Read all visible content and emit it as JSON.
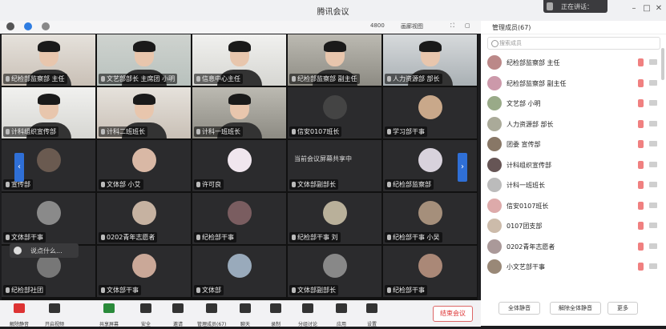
{
  "window": {
    "title": "腾讯会议",
    "speaking_label": "正在讲话："
  },
  "subbar": {
    "layout_label": "画廊视图",
    "signal_label": "4800"
  },
  "grid": {
    "tiles": [
      {
        "name": "纪检部监察部 主任",
        "kind": "video",
        "v": "v1"
      },
      {
        "name": "文艺部部长 主席团 小明",
        "kind": "video",
        "v": "v2"
      },
      {
        "name": "信息中心主任",
        "kind": "video",
        "v": "v3"
      },
      {
        "name": "纪检部监察部 副主任",
        "kind": "video",
        "v": "v4"
      },
      {
        "name": "人力资源部 部长",
        "kind": "video",
        "v": "v5"
      },
      {
        "name": "计科组织宣传部",
        "kind": "video",
        "v": "v3"
      },
      {
        "name": "计科二班班长",
        "kind": "video",
        "v": "v1"
      },
      {
        "name": "计科一班班长",
        "kind": "video",
        "v": "v4"
      },
      {
        "name": "信安0107班长",
        "kind": "avatar",
        "v": "#444"
      },
      {
        "name": "学习部干事",
        "kind": "avatar",
        "v": "#c9a88a"
      },
      {
        "name": "宣传部",
        "kind": "avatar",
        "v": "#6a5a50"
      },
      {
        "name": "文体部 小艾",
        "kind": "avatar",
        "v": "#d9b8a5"
      },
      {
        "name": "许可良",
        "kind": "avatar",
        "v": "#f0e6ee"
      },
      {
        "name": "文体部副部长",
        "kind": "caption",
        "v": "#2b2b2d"
      },
      {
        "name": "纪检部监察部",
        "kind": "avatar",
        "v": "#d8d2dc"
      },
      {
        "name": "文体部干事",
        "kind": "avatar",
        "v": "#8a8a8a"
      },
      {
        "name": "0202青年志愿者",
        "kind": "avatar",
        "v": "#c6b2a1"
      },
      {
        "name": "纪检部干事",
        "kind": "avatar",
        "v": "#7a5d60"
      },
      {
        "name": "纪检部干事 刘",
        "kind": "avatar",
        "v": "#b9b09a"
      },
      {
        "name": "纪检部干事 小吴",
        "kind": "avatar",
        "v": "#a58f7b"
      },
      {
        "name": "纪检部社团",
        "kind": "avatar",
        "v": "#777"
      },
      {
        "name": "文体部干事",
        "kind": "avatar",
        "v": "#caa898"
      },
      {
        "name": "文体部",
        "kind": "avatar",
        "v": "#9ab"
      },
      {
        "name": "文体部副部长",
        "kind": "avatar",
        "v": "#888"
      },
      {
        "name": "纪检部干事",
        "kind": "avatar",
        "v": "#a87"
      }
    ],
    "caption_text": "当前会议屏幕共享中",
    "chat_popup": "说点什么..."
  },
  "toolbar": {
    "items": [
      {
        "label": "解除静音"
      },
      {
        "label": "开启视频"
      },
      {
        "label": "共享屏幕"
      },
      {
        "label": "安全"
      },
      {
        "label": "邀请"
      },
      {
        "label": "管理成员(67)"
      },
      {
        "label": "聊天"
      },
      {
        "label": "录制"
      },
      {
        "label": "分组讨论"
      },
      {
        "label": "应用"
      },
      {
        "label": "设置"
      }
    ],
    "end_label": "结束会议"
  },
  "panel": {
    "title": "管理成员(67)",
    "search_placeholder": "搜索成员",
    "participants": [
      {
        "name": "纪检部监察部 主任",
        "av": "#b88"
      },
      {
        "name": "纪检部监察部 副主任",
        "av": "#c9a"
      },
      {
        "name": "文艺部 小明",
        "av": "#9a8"
      },
      {
        "name": "人力资源部 部长",
        "av": "#aa9"
      },
      {
        "name": "团委 宣传部",
        "av": "#876"
      },
      {
        "name": "计科组织宣传部",
        "av": "#655"
      },
      {
        "name": "计科一班班长",
        "av": "#bbb"
      },
      {
        "name": "信安0107班长",
        "av": "#daa"
      },
      {
        "name": "0107团支部",
        "av": "#cba"
      },
      {
        "name": "0202青年志愿者",
        "av": "#a99"
      },
      {
        "name": "小文艺部干事",
        "av": "#987"
      }
    ],
    "buttons": {
      "mute_all": "全体静音",
      "unmute_all": "解除全体静音",
      "more": "更多"
    }
  }
}
